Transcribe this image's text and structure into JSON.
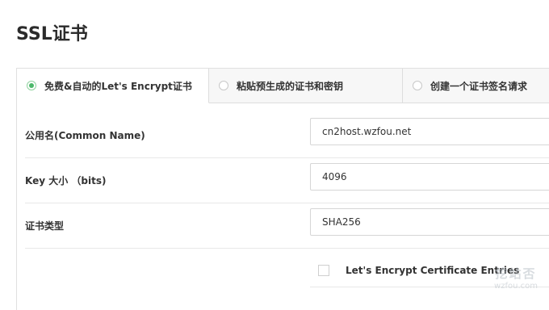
{
  "page": {
    "title": "SSL证书"
  },
  "tabs": [
    {
      "label": "免费&自动的Let's Encrypt证书",
      "selected": true
    },
    {
      "label": "粘贴预生成的证书和密钥",
      "selected": false
    },
    {
      "label": "创建一个证书签名请求",
      "selected": false
    }
  ],
  "form": {
    "common_name": {
      "label": "公用名(Common Name)",
      "value": "cn2host.wzfou.net"
    },
    "key_size": {
      "label": "Key 大小  （bits)",
      "value": "4096"
    },
    "cert_type": {
      "label": "证书类型",
      "value": "SHA256"
    },
    "entries": {
      "label": "Let's Encrypt Certificate Entries",
      "checked": false
    }
  },
  "watermark": {
    "main": "挖站否",
    "sub": "wzfou.com"
  },
  "colors": {
    "radio_selected": "#4cb86b",
    "border": "#dddddd",
    "tab_bg": "#f7f7f7"
  }
}
